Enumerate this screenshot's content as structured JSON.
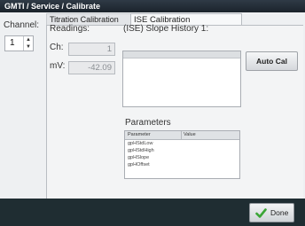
{
  "window": {
    "title": "GMTI / Service / Calibrate"
  },
  "tabs": [
    {
      "label": "Titration Calibration"
    },
    {
      "label": "ISE Calibration"
    }
  ],
  "channel": {
    "label": "Channel:",
    "value": "1"
  },
  "readings": {
    "label": "Readings:",
    "ch_label": "Ch:",
    "ch_value": "1",
    "mv_label": "mV:",
    "mv_value": "-42.09"
  },
  "history": {
    "label": "(ISE) Slope History 1:"
  },
  "buttons": {
    "auto_cal": "Auto Cal",
    "done": "Done"
  },
  "parameters": {
    "label": "Parameters",
    "columns": [
      "Parameter",
      "Value"
    ],
    "rows": [
      "gpHStdLow",
      "gpHStdHigh",
      "gpHSlope",
      "gpHOffset"
    ]
  },
  "icons": {
    "done": "check-icon",
    "stepper_up": "arrow-up-icon",
    "stepper_down": "arrow-down-icon"
  },
  "colors": {
    "titlebar": "#1b232b",
    "bottombar": "#1f2d32",
    "check": "#3aa535"
  }
}
